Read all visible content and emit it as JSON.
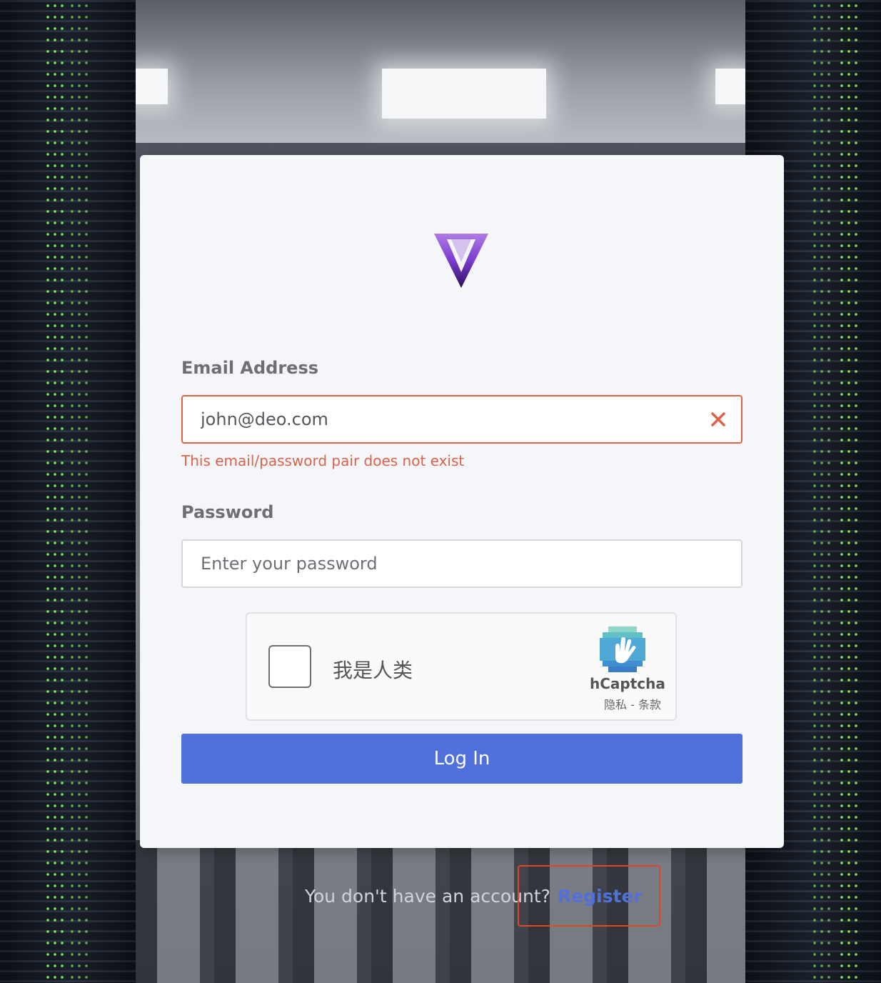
{
  "login": {
    "email_label": "Email Address",
    "email_value": "john@deo.com",
    "email_error": "This email/password pair does not exist",
    "password_label": "Password",
    "password_placeholder": "Enter your password",
    "button_label": "Log In"
  },
  "captcha": {
    "checkbox_label": "我是人类",
    "brand": "hCaptcha",
    "links": "隐私 - 条款"
  },
  "footer": {
    "prompt": "You don't have an account?",
    "register_link": "Register"
  },
  "colors": {
    "primary": "#5170dc",
    "error": "#dd6249",
    "logo_purple": "#6a2bb8"
  },
  "icons": [
    "v-logo-icon",
    "clear-x-icon",
    "hcaptcha-logo-icon"
  ]
}
